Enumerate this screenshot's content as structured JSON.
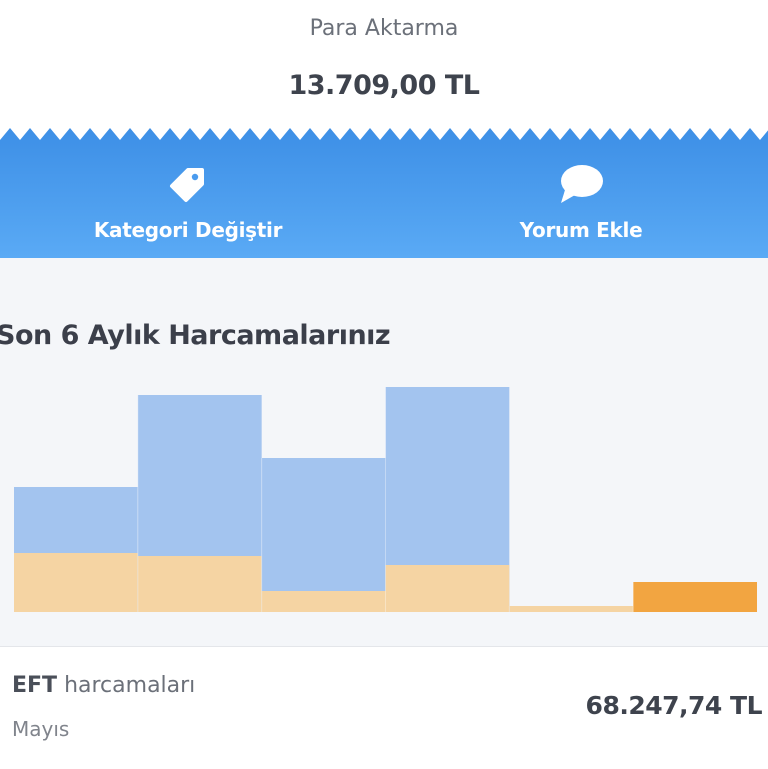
{
  "header": {
    "title": "Para Aktarma",
    "amount": "13.709,00 TL"
  },
  "actions": {
    "change_category": {
      "label": "Kategori Değiştir",
      "icon": "tag-icon"
    },
    "add_comment": {
      "label": "Yorum Ekle",
      "icon": "speech-bubble-icon"
    }
  },
  "colors": {
    "band_top": "#3d8fe6",
    "band_bottom": "#5aaaf5",
    "bar_total": "#a3c4ef",
    "bar_eft": "#f5d4a3",
    "bar_eft_selected": "#f2a541"
  },
  "chart_data": {
    "type": "bar",
    "title": "Son 6 Aylık Harcamalarınız",
    "categories": [
      "",
      "",
      "",
      "",
      "",
      ""
    ],
    "series": [
      {
        "values": [
          125,
          217,
          154,
          225,
          6,
          30
        ]
      },
      {
        "values": [
          59,
          56,
          21,
          47,
          6,
          30
        ]
      }
    ],
    "selected_index": 5,
    "ylim": [
      0,
      240
    ],
    "grid": false
  },
  "detail": {
    "label_bold": "EFT",
    "label_rest": " harcamaları",
    "month": "Mayıs",
    "amount": "68.247,74 TL"
  }
}
